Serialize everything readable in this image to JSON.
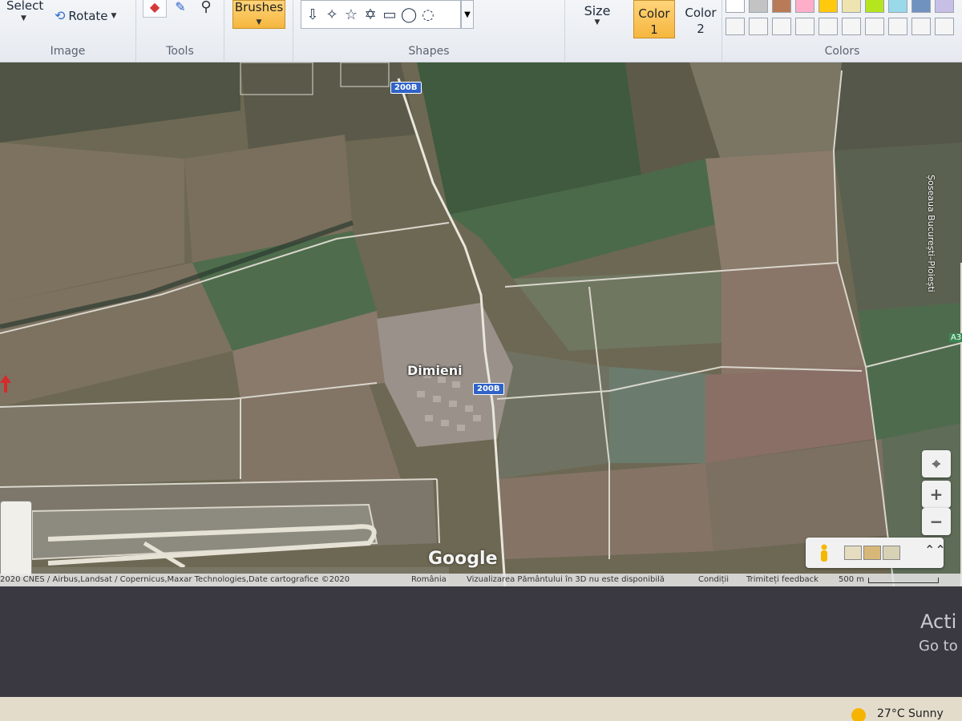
{
  "ribbon": {
    "image_group": {
      "label": "Image",
      "select": "Select",
      "rotate": "Rotate"
    },
    "tools_group": {
      "label": "Tools"
    },
    "brushes": {
      "label": "Brushes"
    },
    "shapes_group": {
      "label": "Shapes"
    },
    "size": {
      "label": "Size"
    },
    "color1": {
      "line1": "Color",
      "line2": "1"
    },
    "color2": {
      "line1": "Color",
      "line2": "2"
    },
    "colors_group": {
      "label": "Colors"
    },
    "palette_row1": [
      "#ffffff",
      "#c3c3c3",
      "#b97a57",
      "#ffaec9",
      "#ffc90e",
      "#efe4b0",
      "#b5e61d",
      "#99d9ea",
      "#7092be",
      "#c8bfe7"
    ],
    "palette_row2": [
      "#f5f5f5",
      "#f5f5f5",
      "#f5f5f5",
      "#f5f5f5",
      "#f5f5f5",
      "#f5f5f5",
      "#f5f5f5",
      "#f5f5f5",
      "#f5f5f5",
      "#f5f5f5"
    ]
  },
  "map": {
    "place_name": "Dimieni",
    "road_shields": [
      "200B",
      "200B"
    ],
    "side_road_label": "Șoseaua București–Ploiești",
    "side_road_tag": "A3",
    "logo": "Google",
    "attribution": {
      "imagery": "2020 CNES / Airbus,Landsat / Copernicus,Maxar Technologies,Date cartografice ©2020",
      "country": "România",
      "notice_3d": "Vizualizarea Pământului în 3D nu este disponibilă",
      "terms": "Condiții",
      "feedback": "Trimiteți feedback",
      "scale": "500 m"
    },
    "controls": {
      "zoom_in": "+",
      "zoom_out": "−",
      "locate_icon": "crosshair-icon",
      "expand": "⌃⌃"
    }
  },
  "windows": {
    "activate_line1": "Acti",
    "activate_line2": "Go to"
  },
  "taskbar": {
    "weather": "27°C  Sunny"
  }
}
